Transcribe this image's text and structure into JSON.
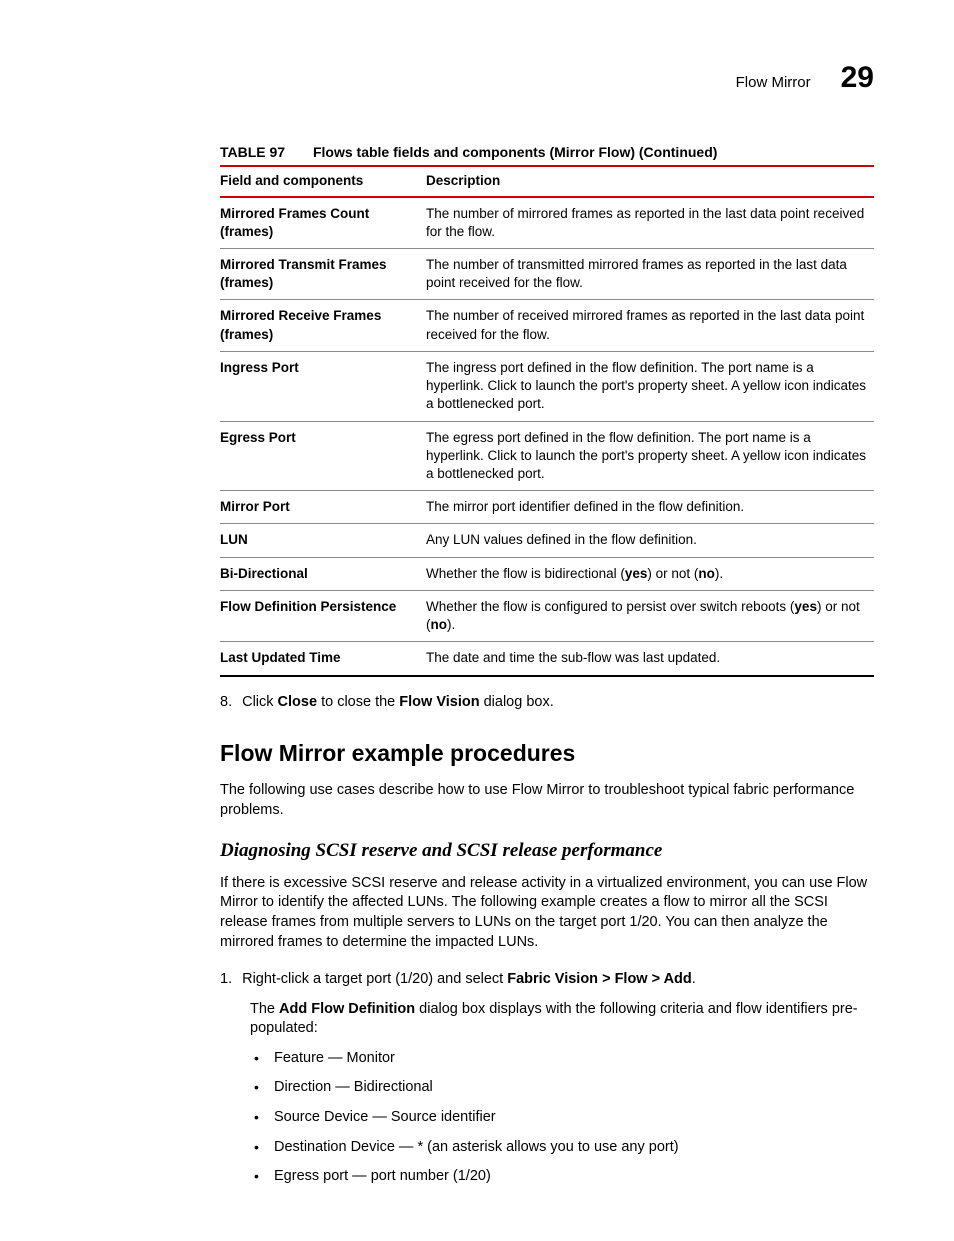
{
  "header": {
    "section": "Flow Mirror",
    "chapter": "29"
  },
  "table": {
    "label": "TABLE 97",
    "title": "Flows table fields and components (Mirror Flow) (Continued)",
    "col1": "Field and components",
    "col2": "Description",
    "rows": [
      {
        "field": "Mirrored Frames Count (frames)",
        "desc": "The number of mirrored frames as reported in the last data point received for the flow."
      },
      {
        "field": "Mirrored Transmit Frames (frames)",
        "desc": "The number of transmitted mirrored frames as reported in the last data point received for the flow."
      },
      {
        "field": "Mirrored Receive Frames (frames)",
        "desc": "The number of received mirrored frames as reported in the last data point received for the flow."
      },
      {
        "field": "Ingress Port",
        "desc": "The ingress port defined in the flow definition. The port name is a hyperlink. Click to launch the port's property sheet. A yellow icon indicates a bottlenecked port."
      },
      {
        "field": "Egress Port",
        "desc": "The egress port defined in the flow definition. The port name is a hyperlink. Click to launch the port's property sheet. A yellow icon indicates a bottlenecked port."
      },
      {
        "field": "Mirror Port",
        "desc": "The mirror port identifier defined in the flow definition."
      },
      {
        "field": "LUN",
        "desc": "Any LUN values defined in the flow definition."
      },
      {
        "field": "Bi-Directional",
        "desc_pre": "Whether the flow is bidirectional (",
        "yes": "yes",
        "desc_mid": ") or not (",
        "no": "no",
        "desc_post": ")."
      },
      {
        "field": "Flow Definition Persistence",
        "desc_pre": "Whether the flow is configured to persist over switch reboots (",
        "yes": "yes",
        "desc_mid": ") or not (",
        "no": "no",
        "desc_post": ")."
      },
      {
        "field": "Last Updated Time",
        "desc": "The date and time the sub-flow was last updated."
      }
    ]
  },
  "step8": {
    "num": "8.",
    "pre": "Click ",
    "bold1": "Close",
    "mid": " to close the ",
    "bold2": "Flow Vision",
    "post": " dialog box."
  },
  "h2": "Flow Mirror example procedures",
  "p1": "The following use cases describe how to use Flow Mirror to troubleshoot typical fabric performance problems.",
  "h3": "Diagnosing SCSI reserve and SCSI release performance",
  "p2": "If there is excessive SCSI reserve and release activity in a virtualized environment, you can use Flow Mirror to identify the affected LUNs. The following example creates a flow to mirror all the SCSI release frames from multiple servers to LUNs on the target port 1/20. You can then analyze the mirrored frames to determine the impacted LUNs.",
  "step1": {
    "num": "1.",
    "pre": "Right-click a target port (1/20) and select ",
    "bold": "Fabric Vision > Flow > Add",
    "post": "."
  },
  "step1body": {
    "pre": "The ",
    "bold": "Add Flow Definition",
    "post": " dialog box displays with the following criteria and flow identifiers pre-populated:"
  },
  "bullets": [
    "Feature — Monitor",
    "Direction — Bidirectional",
    "Source Device — Source identifier",
    "Destination Device — * (an asterisk allows you to use any port)",
    "Egress port — port number (1/20)"
  ]
}
